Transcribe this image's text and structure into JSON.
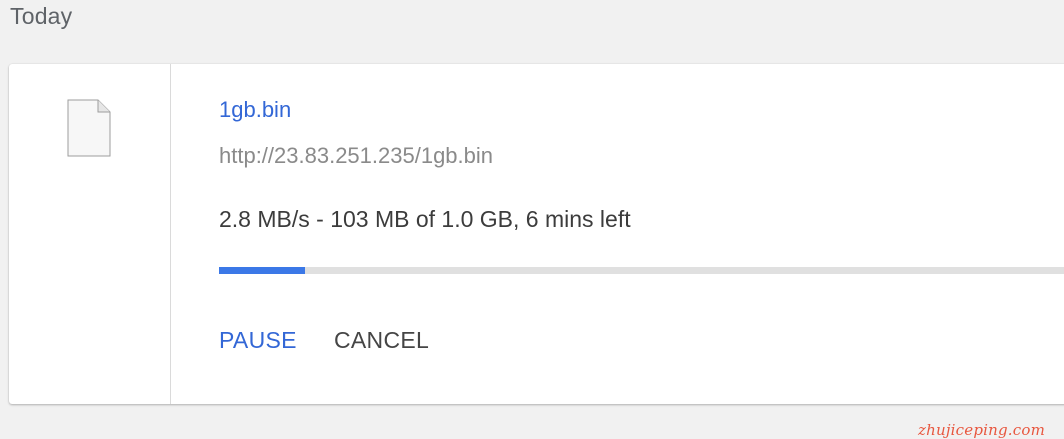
{
  "section": {
    "heading": "Today"
  },
  "download": {
    "icon": "file-icon",
    "file_name": "1gb.bin",
    "url": "http://23.83.251.235/1gb.bin",
    "status": "2.8 MB/s - 103 MB of 1.0 GB, 6 mins left",
    "progress_fraction": 0.1,
    "colors": {
      "link": "#3367d6",
      "progress": "#3b78e7",
      "track": "#e0e0e0"
    },
    "actions": {
      "pause_label": "PAUSE",
      "cancel_label": "CANCEL"
    }
  },
  "watermark": {
    "text": "zhujiceping.com"
  }
}
